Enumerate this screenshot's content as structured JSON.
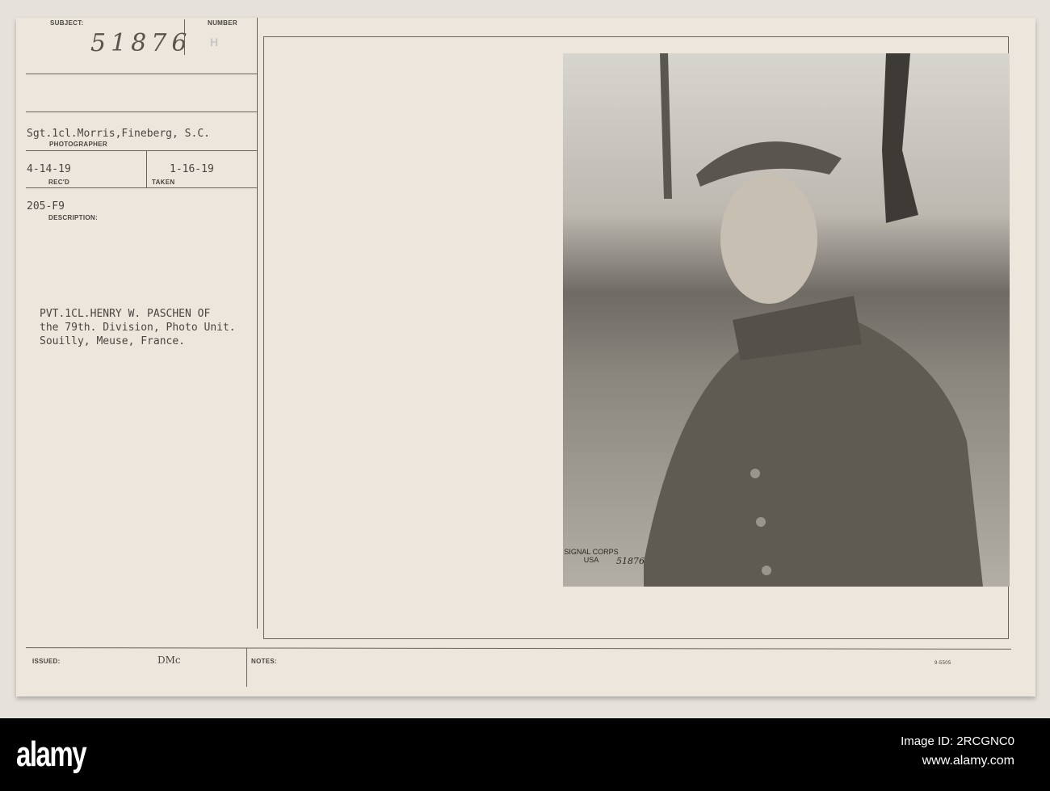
{
  "record": {
    "subject_label": "SUBJECT:",
    "subject_number": "51876",
    "number_label": "NUMBER",
    "number_stamp": "H",
    "photographer": "Sgt.1cl.Morris,Fineberg, S.C.",
    "photographer_label": "PHOTOGRAPHER",
    "received": "4-14-19",
    "received_label": "REC'D",
    "taken": "1-16-19",
    "taken_label": "TAKEN",
    "file_code": "205-F9",
    "description_label": "DESCRIPTION:",
    "description_lines": [
      "PVT.1CL.HENRY W. PASCHEN OF",
      "the 79th. Division, Photo Unit.",
      "Souilly, Meuse, France."
    ],
    "issued_label": "ISSUED:",
    "issued_value": "DMc",
    "notes_label": "NOTES:",
    "form_code": "9-5505"
  },
  "photo": {
    "stamp_text": "SIGNAL CORPS USA",
    "stamp_number": "51876"
  },
  "watermark": {
    "logo": "alamy",
    "image_id": "Image ID: 2RCGNC0",
    "url": "www.alamy.com"
  },
  "colors": {
    "paper": "#ece6dd",
    "ink": "#4a4540"
  }
}
